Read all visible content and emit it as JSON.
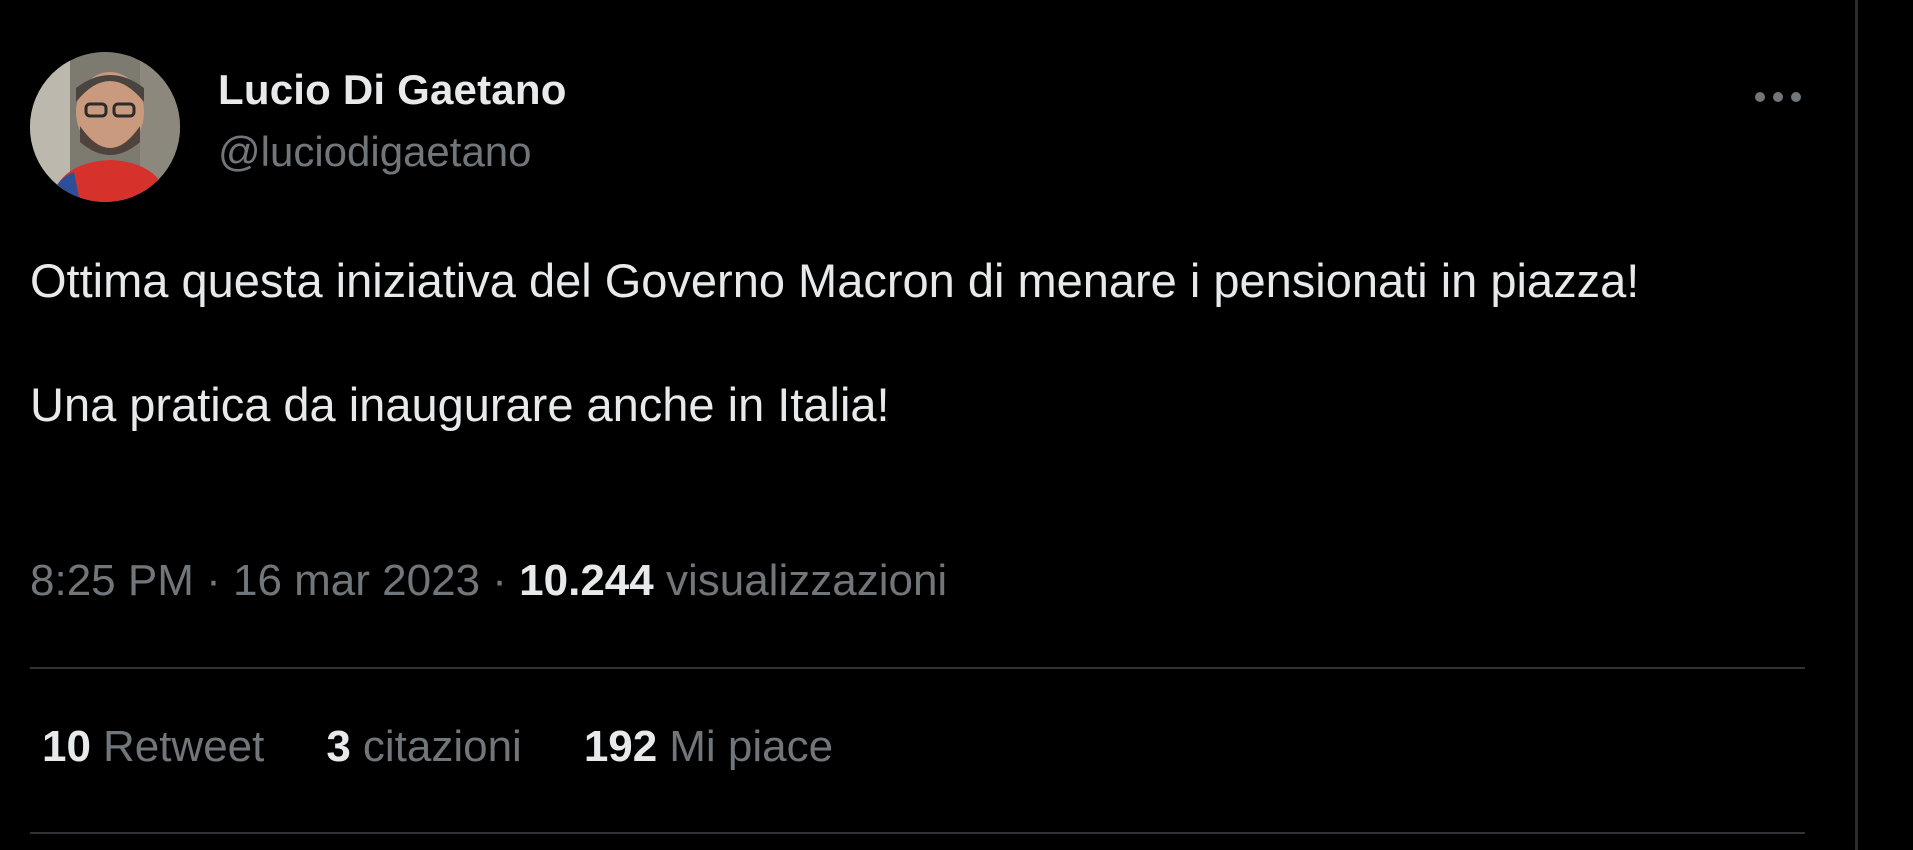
{
  "author": {
    "display_name": "Lucio Di Gaetano",
    "handle": "@luciodigaetano",
    "avatar_icon": "profile-photo"
  },
  "header": {
    "more_icon": "more-horizontal-icon"
  },
  "tweet": {
    "line1": "Ottima questa iniziativa del Governo Macron di menare i pensionati in piazza!",
    "line2": "Una pratica da inaugurare anche in Italia!"
  },
  "meta": {
    "time": "8:25 PM",
    "separator": " · ",
    "date": "16 mar 2023",
    "views_count": "10.244",
    "views_label": "visualizzazioni"
  },
  "stats": {
    "retweets_count": "10",
    "retweets_label": "Retweet",
    "quotes_count": "3",
    "quotes_label": "citazioni",
    "likes_count": "192",
    "likes_label": "Mi piace"
  },
  "colors": {
    "background": "#000000",
    "primary_text": "#e7e9ea",
    "secondary_text": "#71767b",
    "divider": "#2f3336"
  }
}
